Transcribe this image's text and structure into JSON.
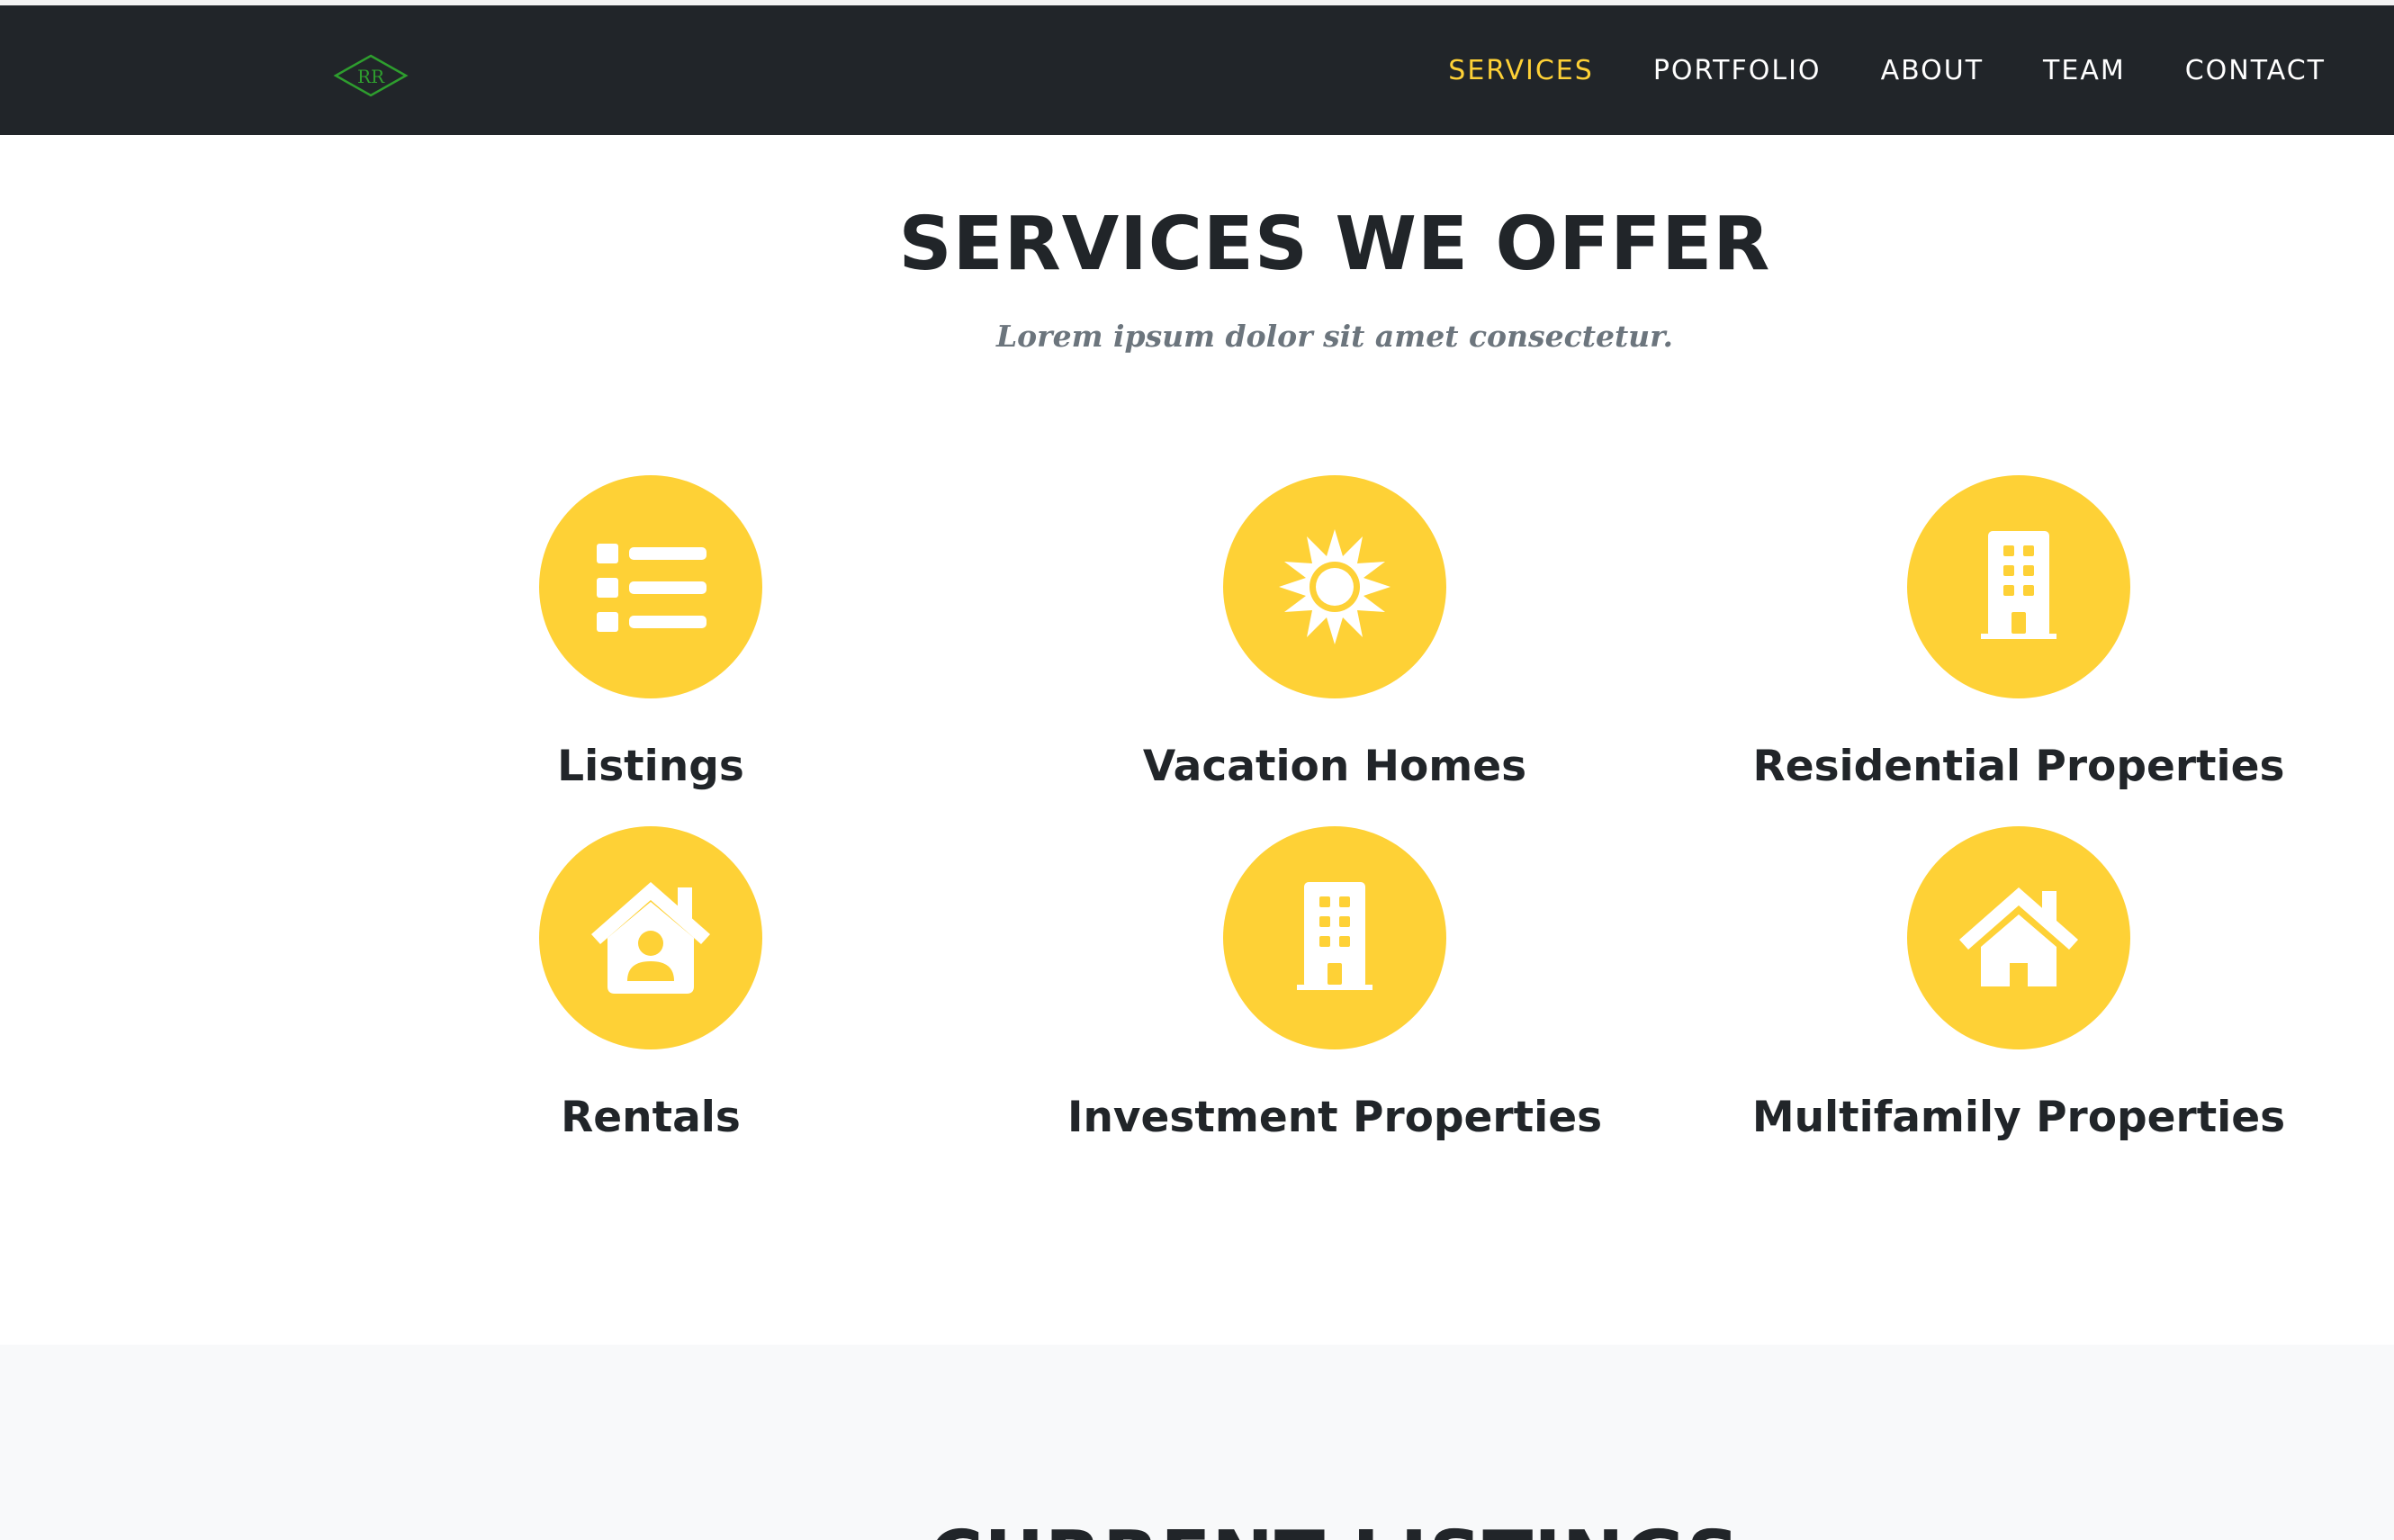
{
  "navbar": {
    "brand_initials": "RR",
    "links": [
      {
        "label": "Services",
        "active": true
      },
      {
        "label": "Portfolio",
        "active": false
      },
      {
        "label": "About",
        "active": false
      },
      {
        "label": "Team",
        "active": false
      },
      {
        "label": "Contact",
        "active": false
      }
    ]
  },
  "services_section": {
    "heading": "SERVICES WE OFFER",
    "subheading": "Lorem ipsum dolor sit amet consectetur.",
    "items": [
      {
        "title": "Listings",
        "icon": "list-icon"
      },
      {
        "title": "Vacation Homes",
        "icon": "sun-icon"
      },
      {
        "title": "Residential Properties",
        "icon": "building-icon"
      },
      {
        "title": "Rentals",
        "icon": "house-user-icon"
      },
      {
        "title": "Investment Properties",
        "icon": "building-icon"
      },
      {
        "title": "Multifamily Properties",
        "icon": "home-icon"
      }
    ]
  },
  "listings_section": {
    "heading": "CURRENT LISTINGS"
  },
  "colors": {
    "navbar_bg": "#212529",
    "accent": "#fed136",
    "heading_text": "#212529",
    "muted_text": "#6c757d",
    "band_bg": "#f8f9fa",
    "brand_logo": "#2e9e2e"
  }
}
